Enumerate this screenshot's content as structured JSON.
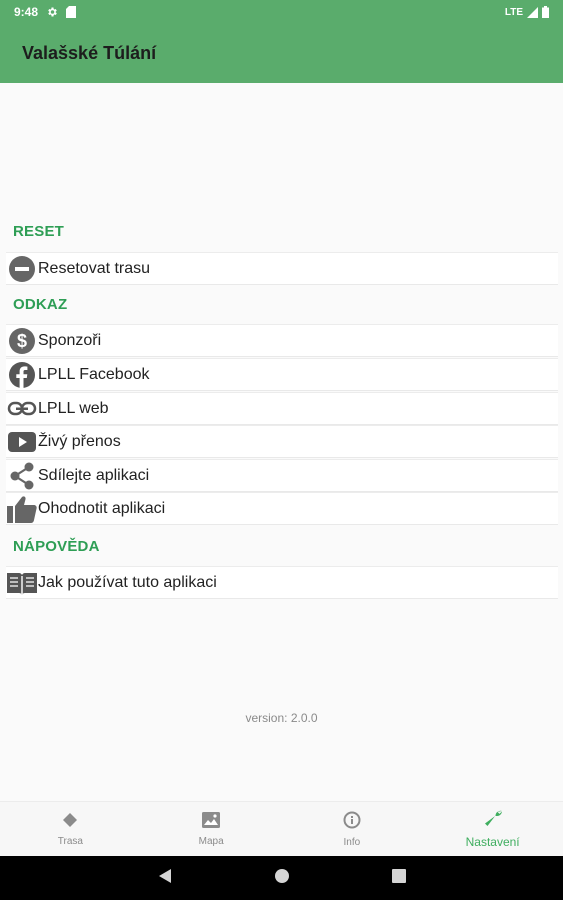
{
  "status_bar": {
    "time": "9:48",
    "network": "LTE",
    "icons": [
      "gear-icon",
      "sd-card-icon",
      "signal-icon",
      "battery-icon"
    ]
  },
  "toolbar": {
    "title": "Valašské Túlání"
  },
  "sections": {
    "reset": {
      "header": "RESET",
      "items": [
        {
          "label": "Resetovat trasu",
          "icon": "minus-circle-icon"
        }
      ]
    },
    "odkaz": {
      "header": "ODKAZ",
      "items": [
        {
          "label": "Sponzoři",
          "icon": "dollar-circle-icon"
        },
        {
          "label": "LPLL Facebook",
          "icon": "facebook-icon"
        },
        {
          "label": "LPLL web",
          "icon": "link-icon"
        },
        {
          "label": "Živý přenos",
          "icon": "youtube-icon"
        },
        {
          "label": "Sdílejte aplikaci",
          "icon": "share-icon"
        },
        {
          "label": "Ohodnotit aplikaci",
          "icon": "thumbs-up-icon"
        }
      ]
    },
    "napoveda": {
      "header": "NÁPOVĚDA",
      "items": [
        {
          "label": "Jak používat tuto aplikaci",
          "icon": "book-icon"
        }
      ]
    }
  },
  "version": "version: 2.0.0",
  "bottom_nav": {
    "items": [
      {
        "label": "Trasa",
        "icon": "diamond-icon",
        "active": false
      },
      {
        "label": "Mapa",
        "icon": "map-image-icon",
        "active": false
      },
      {
        "label": "Info",
        "icon": "info-icon",
        "active": false
      },
      {
        "label": "Nastavení",
        "icon": "wrench-icon",
        "active": true
      }
    ]
  },
  "colors": {
    "primary": "#5aac6c",
    "accent": "#2e9e55",
    "icon_gray": "#666666"
  }
}
